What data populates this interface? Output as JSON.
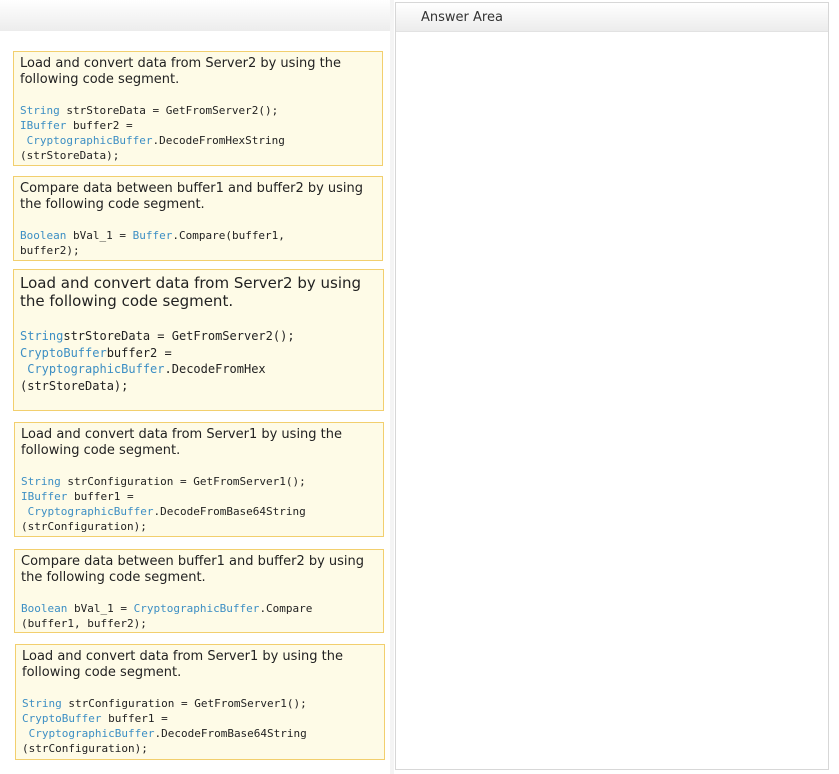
{
  "answer_area": {
    "title": "Answer Area"
  },
  "cards": [
    {
      "desc": "Load and convert data from Server2 by using the following code segment.",
      "lines": [
        [
          {
            "t": "String",
            "k": true
          },
          {
            "t": " strStoreData = GetFromServer2();"
          }
        ],
        [
          {
            "t": "IBuffer",
            "k": true
          },
          {
            "t": " buffer2 ="
          }
        ],
        [
          {
            "t": " "
          },
          {
            "t": "CryptographicBuffer",
            "k": true
          },
          {
            "t": ".DecodeFromHexString"
          }
        ],
        [
          {
            "t": "(strStoreData);"
          }
        ]
      ]
    },
    {
      "desc": "Compare data between buffer1 and buffer2 by using the following code segment.",
      "lines": [
        [
          {
            "t": "Boolean",
            "k": true
          },
          {
            "t": " bVal_1 = "
          },
          {
            "t": "Buffer",
            "k": true
          },
          {
            "t": ".Compare(buffer1,"
          }
        ],
        [
          {
            "t": "buffer2);"
          }
        ]
      ]
    },
    {
      "desc": "Load and convert data from Server2 by using the following code segment.",
      "lines": [
        [
          {
            "t": "String",
            "k": true
          },
          {
            "t": "strStoreData = GetFromServer2();"
          }
        ],
        [
          {
            "t": "CryptoBuffer",
            "k": true
          },
          {
            "t": "buffer2 ="
          }
        ],
        [
          {
            "t": " "
          },
          {
            "t": "CryptographicBuffer",
            "k": true
          },
          {
            "t": ".DecodeFromHex"
          }
        ],
        [
          {
            "t": "(strStoreData);"
          }
        ]
      ]
    },
    {
      "desc": "Load and convert data from Server1 by using the following code segment.",
      "lines": [
        [
          {
            "t": "String",
            "k": true
          },
          {
            "t": " strConfiguration = GetFromServer1();"
          }
        ],
        [
          {
            "t": "IBuffer",
            "k": true
          },
          {
            "t": " buffer1 ="
          }
        ],
        [
          {
            "t": " "
          },
          {
            "t": "CryptographicBuffer",
            "k": true
          },
          {
            "t": ".DecodeFromBase64String"
          }
        ],
        [
          {
            "t": "(strConfiguration);"
          }
        ]
      ]
    },
    {
      "desc": "Compare data between buffer1 and buffer2 by using the following code segment.",
      "lines": [
        [
          {
            "t": "Boolean",
            "k": true
          },
          {
            "t": " bVal_1 = "
          },
          {
            "t": "CryptographicBuffer",
            "k": true
          },
          {
            "t": ".Compare"
          }
        ],
        [
          {
            "t": "(buffer1, buffer2);"
          }
        ]
      ]
    },
    {
      "desc": "Load and convert data from Server1 by using the following code segment.",
      "lines": [
        [
          {
            "t": "String",
            "k": true
          },
          {
            "t": " strConfiguration = GetFromServer1();"
          }
        ],
        [
          {
            "t": "CryptoBuffer",
            "k": true
          },
          {
            "t": " buffer1 ="
          }
        ],
        [
          {
            "t": " "
          },
          {
            "t": "CryptographicBuffer",
            "k": true
          },
          {
            "t": ".DecodeFromBase64String"
          }
        ],
        [
          {
            "t": "(strConfiguration);"
          }
        ]
      ]
    }
  ]
}
